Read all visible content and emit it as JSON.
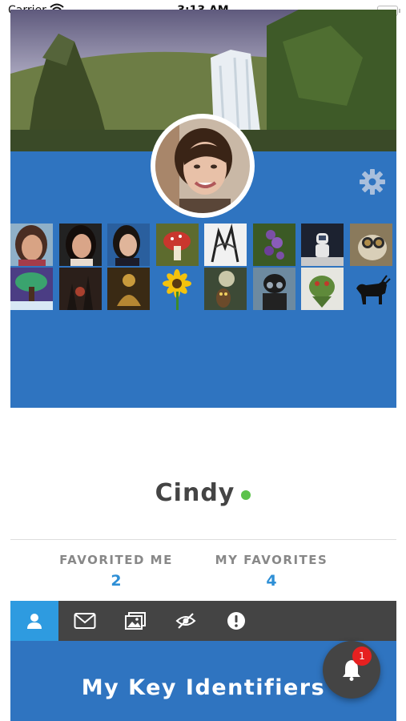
{
  "status_bar": {
    "carrier": "Carrier",
    "time": "3:13 AM"
  },
  "profile": {
    "name": "Cindy",
    "online_color": "#5cc24b"
  },
  "stats": [
    {
      "label": "FAVORITED ME",
      "value": "2"
    },
    {
      "label": "MY FAVORITES",
      "value": "4"
    }
  ],
  "tabs": [
    {
      "icon": "user-icon",
      "active": true
    },
    {
      "icon": "mail-icon",
      "active": false
    },
    {
      "icon": "photos-icon",
      "active": false
    },
    {
      "icon": "hidden-eye-icon",
      "active": false
    },
    {
      "icon": "alert-icon",
      "active": false
    }
  ],
  "section": {
    "title": "My Key Identifiers"
  },
  "notifications": {
    "icon": "bell-icon",
    "count": "1"
  },
  "colors": {
    "panel_blue": "#2f74c0",
    "tab_active": "#2e9be0",
    "tab_bar": "#444444",
    "stat_value": "#2e8fd6",
    "badge": "#e62020"
  },
  "gallery": [
    "portrait-woman-1",
    "portrait-woman-2",
    "portrait-woman-3",
    "red-mushroom",
    "ink-sketch",
    "purple-flowers",
    "astronaut-toy",
    "steampunk-skull",
    "fantasy-tree",
    "dark-forest",
    "golden-statue",
    "sunflower",
    "owl-moon",
    "masked-figure",
    "green-creature",
    "black-bull"
  ]
}
